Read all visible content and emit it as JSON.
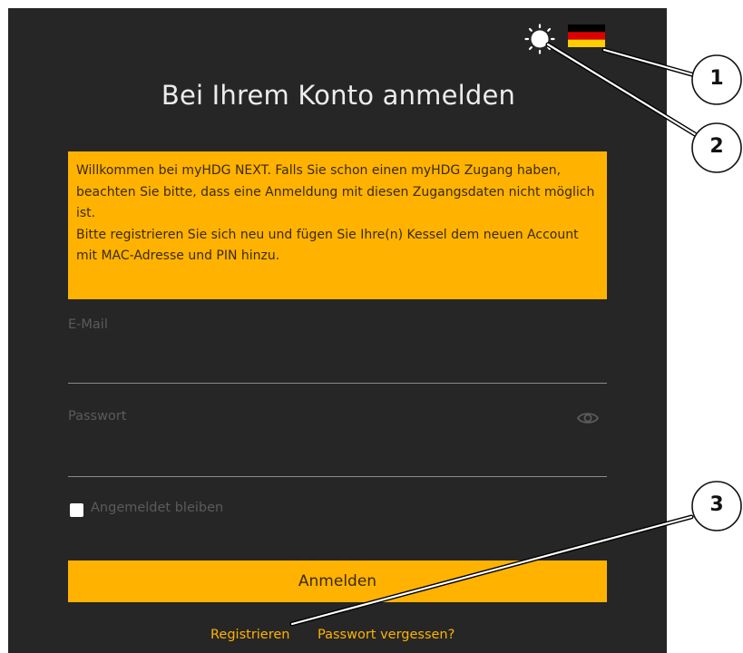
{
  "page": {
    "title": "Bei Ihrem Konto anmelden"
  },
  "header": {
    "theme_icon": "sun-icon",
    "language_icon": "german-flag-icon",
    "flag_colors": [
      "#000000",
      "#dd0000",
      "#ffce00"
    ]
  },
  "notice": {
    "lines": [
      "Willkommen bei myHDG NEXT. Falls Sie schon einen myHDG Zugang haben, beachten Sie bitte, dass eine Anmeldung mit diesen Zugangsdaten nicht möglich ist.",
      "Bitte registrieren Sie sich neu und fügen Sie Ihre(n) Kessel dem neuen Account mit MAC-Adresse und PIN hinzu."
    ]
  },
  "form": {
    "email_label": "E-Mail",
    "email_value": "",
    "password_label": "Passwort",
    "password_value": "",
    "password_toggle_icon": "eye-icon",
    "remember_label": "Angemeldet bleiben",
    "remember_checked": false,
    "submit_label": "Anmelden"
  },
  "links": {
    "register": "Registrieren",
    "forgot_password": "Passwort vergessen?"
  },
  "callouts": [
    "1",
    "2",
    "3"
  ],
  "colors": {
    "background": "#262626",
    "accent": "#ffb300",
    "title_text": "#ececec",
    "muted_text": "#5b5b5b"
  }
}
